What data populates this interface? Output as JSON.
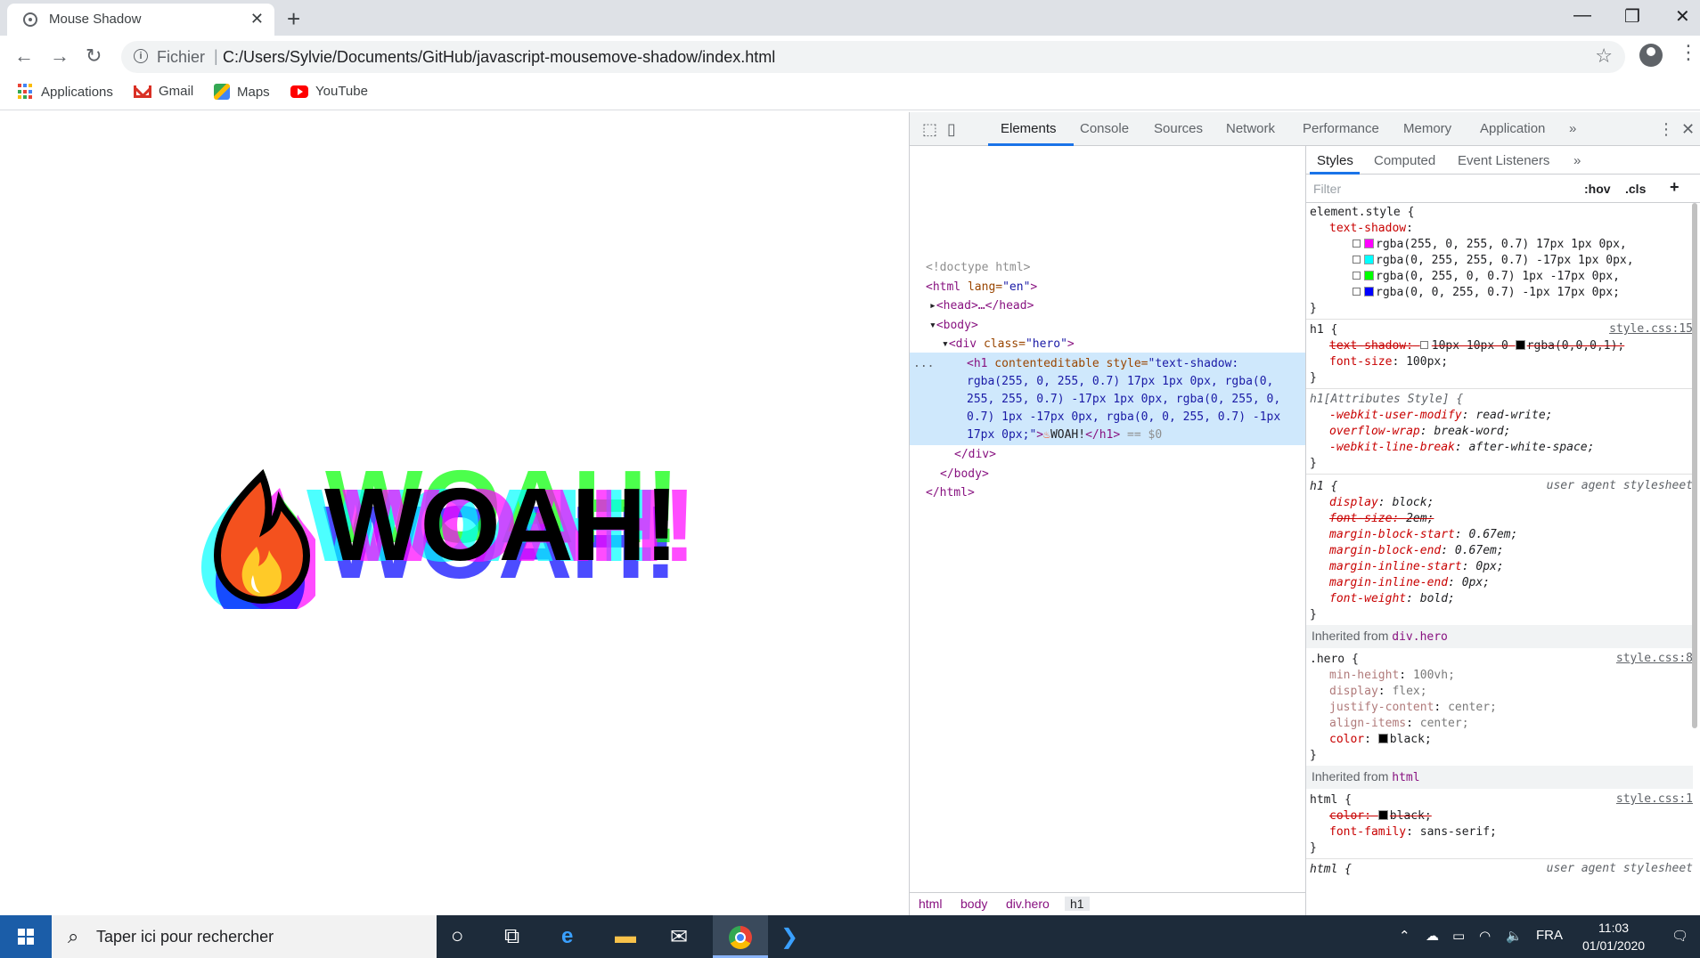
{
  "browser": {
    "tab_title": "Mouse Shadow",
    "tab_close": "✕",
    "new_tab": "+",
    "window_controls": [
      "—",
      "❐",
      "✕"
    ],
    "url_scheme": "Fichier",
    "url_separator": "|",
    "url": "C:/Users/Sylvie/Documents/GitHub/javascript-mousemove-shadow/index.html",
    "bookmarks": [
      "Applications",
      "Gmail",
      "Maps",
      "YouTube"
    ]
  },
  "page": {
    "heading_text": "WOAH!",
    "emoji_name": "fire-emoji"
  },
  "devtools": {
    "main_tabs": [
      "Elements",
      "Console",
      "Sources",
      "Network",
      "Performance",
      "Memory",
      "Application"
    ],
    "active_tab": "Elements",
    "overflow": "»",
    "dom": {
      "doctype": "<!doctype html>",
      "html_open": "<html",
      "lang_attr": " lang=",
      "lang_val": "\"en\"",
      "head": "<head>…</head>",
      "body_open": "<body>",
      "div_open": "<div",
      "class_attr": " class=",
      "class_val": "\"hero\"",
      "h1_open": "<h1",
      "h1_attr1": " contenteditable",
      "h1_attr2": " style=",
      "style_line1": "\"text-shadow:",
      "style_line2": "rgba(255, 0, 255, 0.7) 17px 1px 0px, rgba(0,",
      "style_line3": "255, 255, 0.7) -17px 1px 0px, rgba(0, 255, 0,",
      "style_line4": "0.7) 1px -17px 0px, rgba(0, 0, 255, 0.7) -1px",
      "style_line5": "17px 0px;\"",
      "h1_text": "WOAH!",
      "h1_close": "</h1>",
      "eq": " == $0",
      "div_close": "</div>",
      "body_close": "</body>",
      "html_close": "</html>",
      "row_ellipsis": "..."
    },
    "breadcrumbs": [
      "html",
      "body",
      "div.hero",
      "h1"
    ],
    "side_tabs": [
      "Styles",
      "Computed",
      "Event Listeners"
    ],
    "filter_placeholder": "Filter",
    "hov": ":hov",
    "cls": ".cls",
    "plus": "+",
    "rules": {
      "element_style": "element.style {",
      "ts_prop": "text-shadow",
      "ts_values": [
        {
          "text": "rgba(255, 0, 255, 0.7) 17px 1px 0px,",
          "color": "#ff00ff"
        },
        {
          "text": "rgba(0, 255, 255, 0.7) -17px 1px 0px,",
          "color": "#00ffff"
        },
        {
          "text": "rgba(0, 255, 0, 0.7) 1px -17px 0px,",
          "color": "#00ff00"
        },
        {
          "text": "rgba(0, 0, 255, 0.7) -1px 17px 0px;",
          "color": "#0000ff"
        }
      ],
      "close": "}",
      "h1_sel": "h1 {",
      "h1_src": "style.css:15",
      "h1_ts": "text-shadow:",
      "h1_ts_val1": "10px 10px 0",
      "h1_ts_val2": "rgba(0,0,0,1);",
      "fontsize_prop": "font-size",
      "fontsize_val": "100px;",
      "attr_sel": "h1[Attributes Style] {",
      "attr_props": [
        [
          "-webkit-user-modify",
          "read-write;"
        ],
        [
          "overflow-wrap",
          "break-word;"
        ],
        [
          "-webkit-line-break",
          "after-white-space;"
        ]
      ],
      "ua_sel": "h1 {",
      "ua_src": "user agent stylesheet",
      "ua_props": [
        [
          "display",
          "block;",
          false
        ],
        [
          "font-size",
          "2em;",
          true
        ],
        [
          "margin-block-start",
          "0.67em;",
          false
        ],
        [
          "margin-block-end",
          "0.67em;",
          false
        ],
        [
          "margin-inline-start",
          "0px;",
          false
        ],
        [
          "margin-inline-end",
          "0px;",
          false
        ],
        [
          "font-weight",
          "bold;",
          false
        ]
      ],
      "inh_hero_label": "Inherited from ",
      "inh_hero_sel": "div.hero",
      "hero_sel": ".hero {",
      "hero_src": "style.css:8",
      "hero_props": [
        [
          "min-height",
          "100vh;"
        ],
        [
          "display",
          "flex;"
        ],
        [
          "justify-content",
          "center;"
        ],
        [
          "align-items",
          "center;"
        ]
      ],
      "hero_color_prop": "color",
      "hero_color_val": "black;",
      "inh_html_label": "Inherited from ",
      "inh_html_sel": "html",
      "html_sel": "html {",
      "html_src": "style.css:1",
      "html_color_prop": "color:",
      "html_color_val": "black;",
      "html_ff_prop": "font-family",
      "html_ff_val": "sans-serif;",
      "html_ua_sel": "html {",
      "html_ua_src": "user agent stylesheet"
    }
  },
  "taskbar": {
    "search_placeholder": "Taper ici pour rechercher",
    "lang": "FRA",
    "time": "11:03",
    "date": "01/01/2020"
  },
  "colors": {
    "chrome_tabstrip": "#dee1e6",
    "devtools_selection": "#cfe8fc",
    "taskbar": "#1d2b3a",
    "accent": "#1a73e8"
  }
}
